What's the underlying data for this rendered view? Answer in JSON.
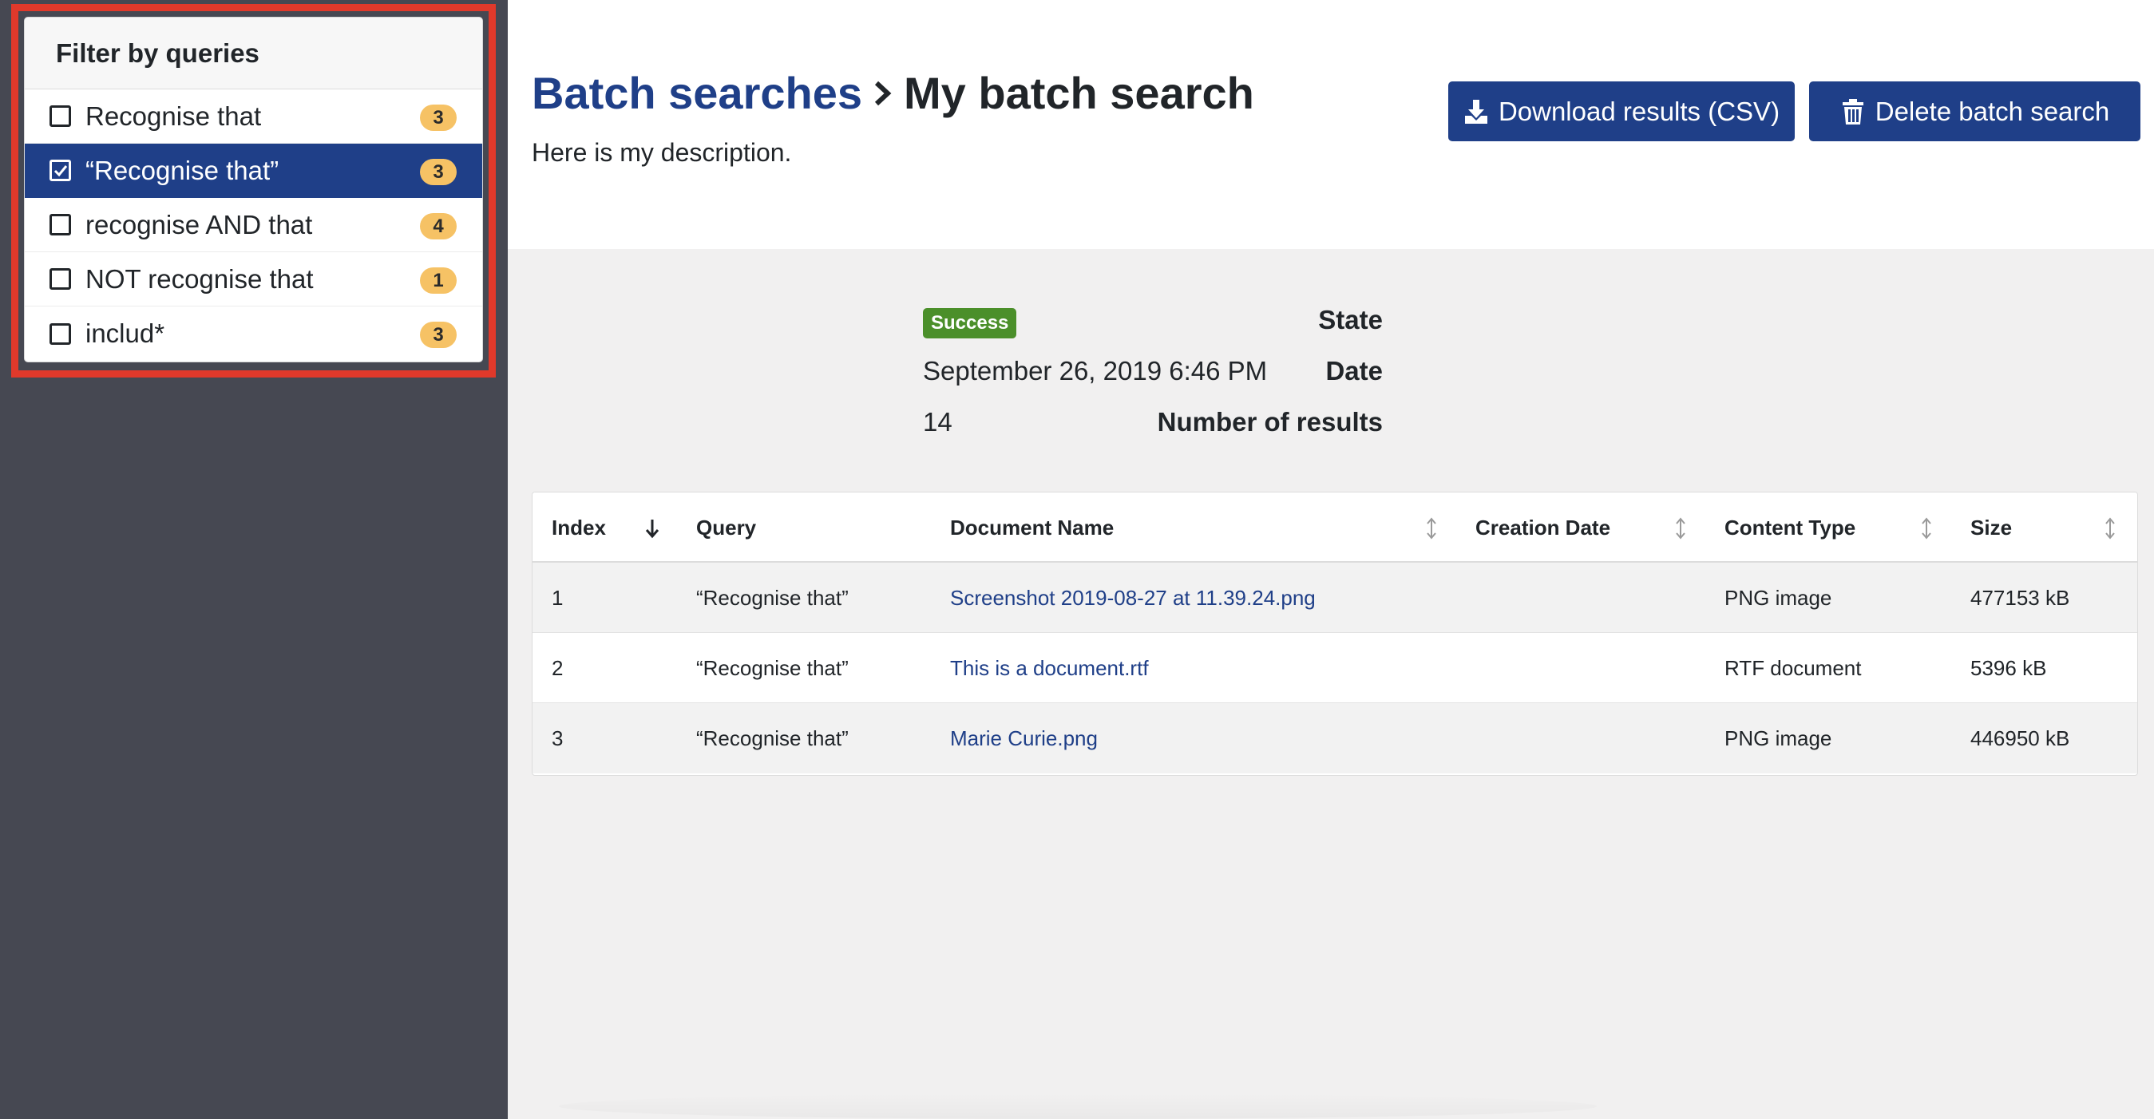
{
  "sidebar": {
    "filter_title": "Filter by queries",
    "queries": [
      {
        "label": "Recognise that",
        "count": "3",
        "checked": false
      },
      {
        "label": "“Recognise that”",
        "count": "3",
        "checked": true
      },
      {
        "label": "recognise AND that",
        "count": "4",
        "checked": false
      },
      {
        "label": "NOT recognise that",
        "count": "1",
        "checked": false
      },
      {
        "label": "includ*",
        "count": "3",
        "checked": false
      }
    ]
  },
  "header": {
    "breadcrumb_parent": "Batch searches",
    "title": "My batch search",
    "description": "Here is my description.",
    "download_label": "Download results (CSV)",
    "delete_label": "Delete batch search"
  },
  "details": {
    "state_label": "State",
    "state_value": "Success",
    "date_label": "Date",
    "date_value": "September 26, 2019 6:46 PM",
    "results_label": "Number of results",
    "results_value": "14"
  },
  "table": {
    "headers": {
      "index": "Index",
      "query": "Query",
      "document_name": "Document Name",
      "creation_date": "Creation Date",
      "content_type": "Content Type",
      "size": "Size"
    },
    "rows": [
      {
        "index": "1",
        "query": "“Recognise that”",
        "document_name": "Screenshot 2019-08-27 at 11.39.24.png",
        "creation_date": "",
        "content_type": "PNG image",
        "size": "477153 kB"
      },
      {
        "index": "2",
        "query": "“Recognise that”",
        "document_name": "This is a document.rtf",
        "creation_date": "",
        "content_type": "RTF document",
        "size": "5396 kB"
      },
      {
        "index": "3",
        "query": "“Recognise that”",
        "document_name": "Marie Curie.png",
        "creation_date": "",
        "content_type": "PNG image",
        "size": "446950 kB"
      }
    ]
  },
  "colors": {
    "brand": "#1f3f88",
    "badge": "#f6c265",
    "success": "#4b8f2a",
    "highlight": "#e0392b",
    "sidebar": "#464852"
  },
  "icons": {
    "breadcrumb_separator": "chevron-right-icon",
    "download": "download-icon",
    "delete": "trash-icon",
    "sort_desc": "arrow-down-icon",
    "sortable": "sort-icon"
  }
}
